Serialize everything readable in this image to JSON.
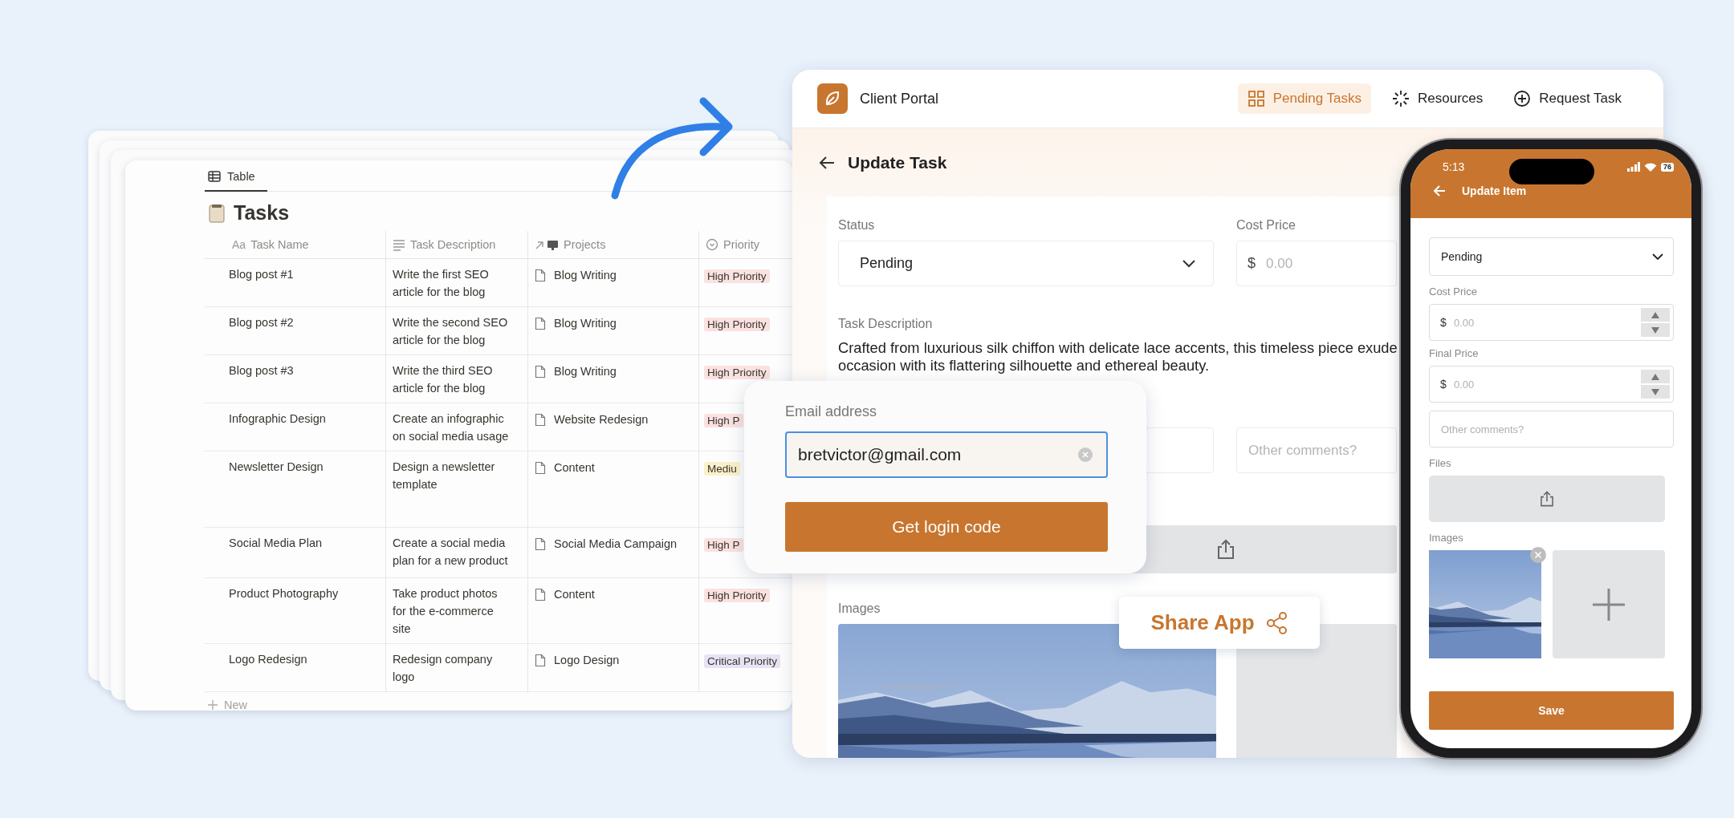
{
  "table_view": {
    "tab": "Table",
    "title": "Tasks",
    "columns": [
      {
        "label": "Task Name",
        "prefix": "Aa"
      },
      {
        "label": "Task Description"
      },
      {
        "label": "Projects"
      },
      {
        "label": "Priority"
      }
    ],
    "rows": [
      {
        "name": "Blog post #1",
        "description": "Write the first SEO article for the blog",
        "project": "Blog Writing",
        "priority": "High Priority",
        "color": "#fbe1df"
      },
      {
        "name": "Blog post #2",
        "description": "Write the second SEO article for the blog",
        "project": "Blog Writing",
        "priority": "High Priority",
        "color": "#fbe1df"
      },
      {
        "name": "Blog post #3",
        "description": "Write the third SEO article for the blog",
        "project": "Blog Writing",
        "priority": "High Priority",
        "color": "#fbe1df"
      },
      {
        "name": "Infographic Design",
        "description": "Create an infographic on social media usage",
        "project": "Website Redesign",
        "priority": "High P",
        "color": "#fbe1df"
      },
      {
        "name": "Newsletter Design",
        "description": "Design a newsletter template",
        "project": "Content",
        "priority": "Mediu",
        "color": "#fbf1c9"
      },
      {
        "name": "Social Media Plan",
        "description": "Create a social media plan for a new product",
        "project": "Social Media Campaign",
        "priority": "High P",
        "color": "#fbe1df"
      },
      {
        "name": "Product Photography",
        "description": "Take product photos for the e-commerce site",
        "project": "Content",
        "priority": "High Priority",
        "color": "#fbe1df"
      },
      {
        "name": "Logo Redesign",
        "description": "Redesign company logo",
        "project": "Logo Design",
        "priority": "Critical Priority",
        "color": "#e7e3f4"
      }
    ],
    "new_row": "New"
  },
  "portal": {
    "brand": "Client Portal",
    "nav": [
      {
        "label": "Pending Tasks",
        "selected": true
      },
      {
        "label": "Resources",
        "selected": false
      },
      {
        "label": "Request Task",
        "selected": false
      }
    ],
    "page_title": "Update Task",
    "status": {
      "label": "Status",
      "value": "Pending"
    },
    "cost_price": {
      "label": "Cost Price",
      "currency": "$",
      "placeholder": "0.00"
    },
    "description": {
      "label": "Task Description",
      "lines": [
        "Crafted from luxurious silk chiffon with delicate lace accents, this timeless piece exude",
        "occasion with its flattering silhouette and ethereal beauty."
      ]
    },
    "comments": {
      "placeholder": "Other comments?"
    },
    "images_label": "Images"
  },
  "login_popup": {
    "label": "Email address",
    "value": "bretvictor@gmail.com",
    "button": "Get login code"
  },
  "share_button": {
    "label": "Share App"
  },
  "phone": {
    "time": "5:13",
    "battery": "76",
    "title": "Update Item",
    "status_value": "Pending",
    "cost_price": {
      "label": "Cost Price",
      "currency": "$",
      "placeholder": "0.00"
    },
    "final_price": {
      "label": "Final Price",
      "currency": "$",
      "placeholder": "0.00"
    },
    "comments": {
      "placeholder": "Other comments?"
    },
    "files_label": "Files",
    "images_label": "Images",
    "save": "Save"
  }
}
